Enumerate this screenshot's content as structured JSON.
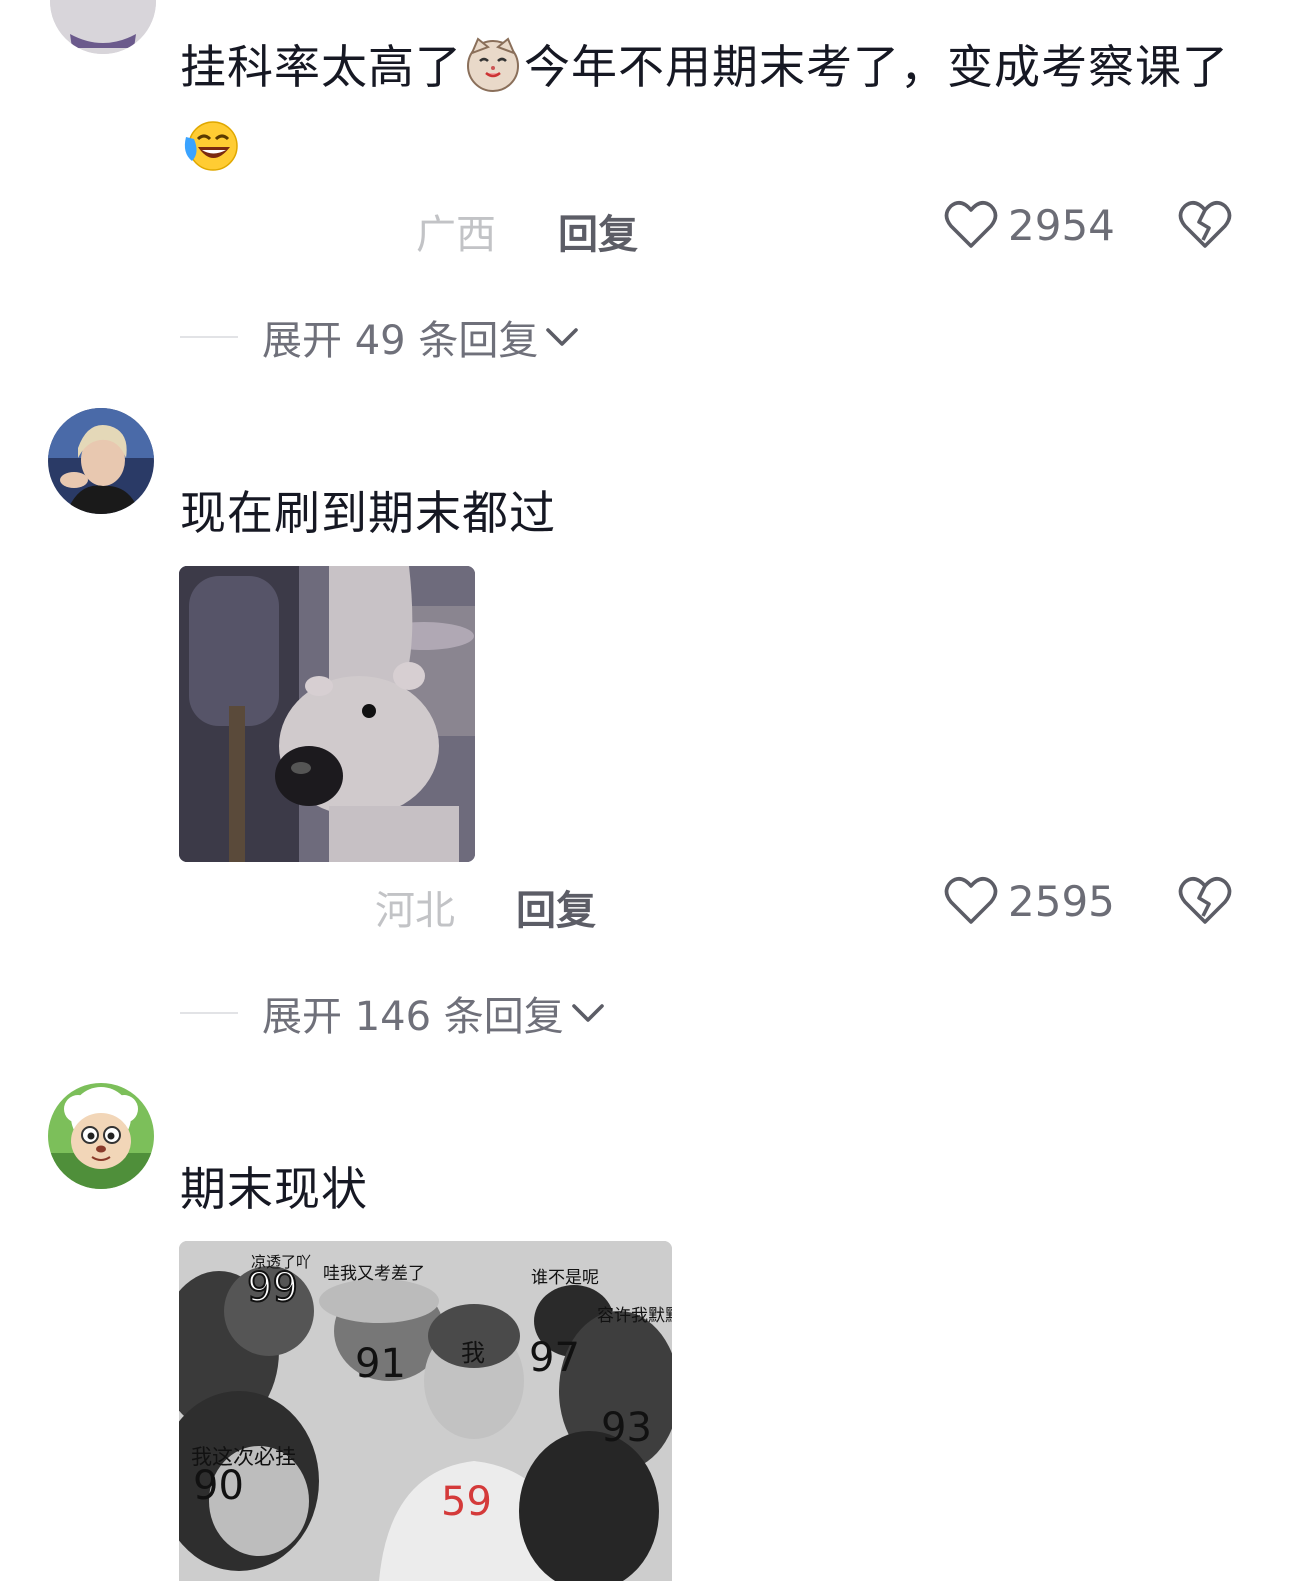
{
  "comments": [
    {
      "text_part1": "挂科率太高了",
      "text_part2": "今年不用期末考了，变成考察课了",
      "emoji1": "cat-emoji",
      "emoji2": "laugh-cry-emoji",
      "location": "广西",
      "reply_label": "回复",
      "likes": "2954",
      "expand_label": "展开 49 条回复"
    },
    {
      "text": "现在刷到期末都过",
      "location": "河北",
      "reply_label": "回复",
      "likes": "2595",
      "expand_label": "展开 146 条回复",
      "image": "rat-meme-image"
    },
    {
      "text": "期末现状",
      "image": "crowd-scores-meme-image",
      "meme_labels": {
        "l1": "凉透了吖",
        "n1": "99",
        "l2": "哇我又考差了",
        "l3": "谁不是呢",
        "l4": "容许我默默",
        "n2": "91",
        "n3": "我",
        "n4": "97",
        "n5": "93",
        "l5": "我这次必挂",
        "n6": "90",
        "n7": "59"
      }
    }
  ],
  "icons": {
    "like": "heart-outline-icon",
    "dislike": "broken-heart-icon",
    "chevron": "chevron-down-icon"
  },
  "colors": {
    "text": "#161823",
    "muted": "#c2c3c6",
    "reply": "#5c5d66",
    "score_red": "#d43a3a"
  }
}
